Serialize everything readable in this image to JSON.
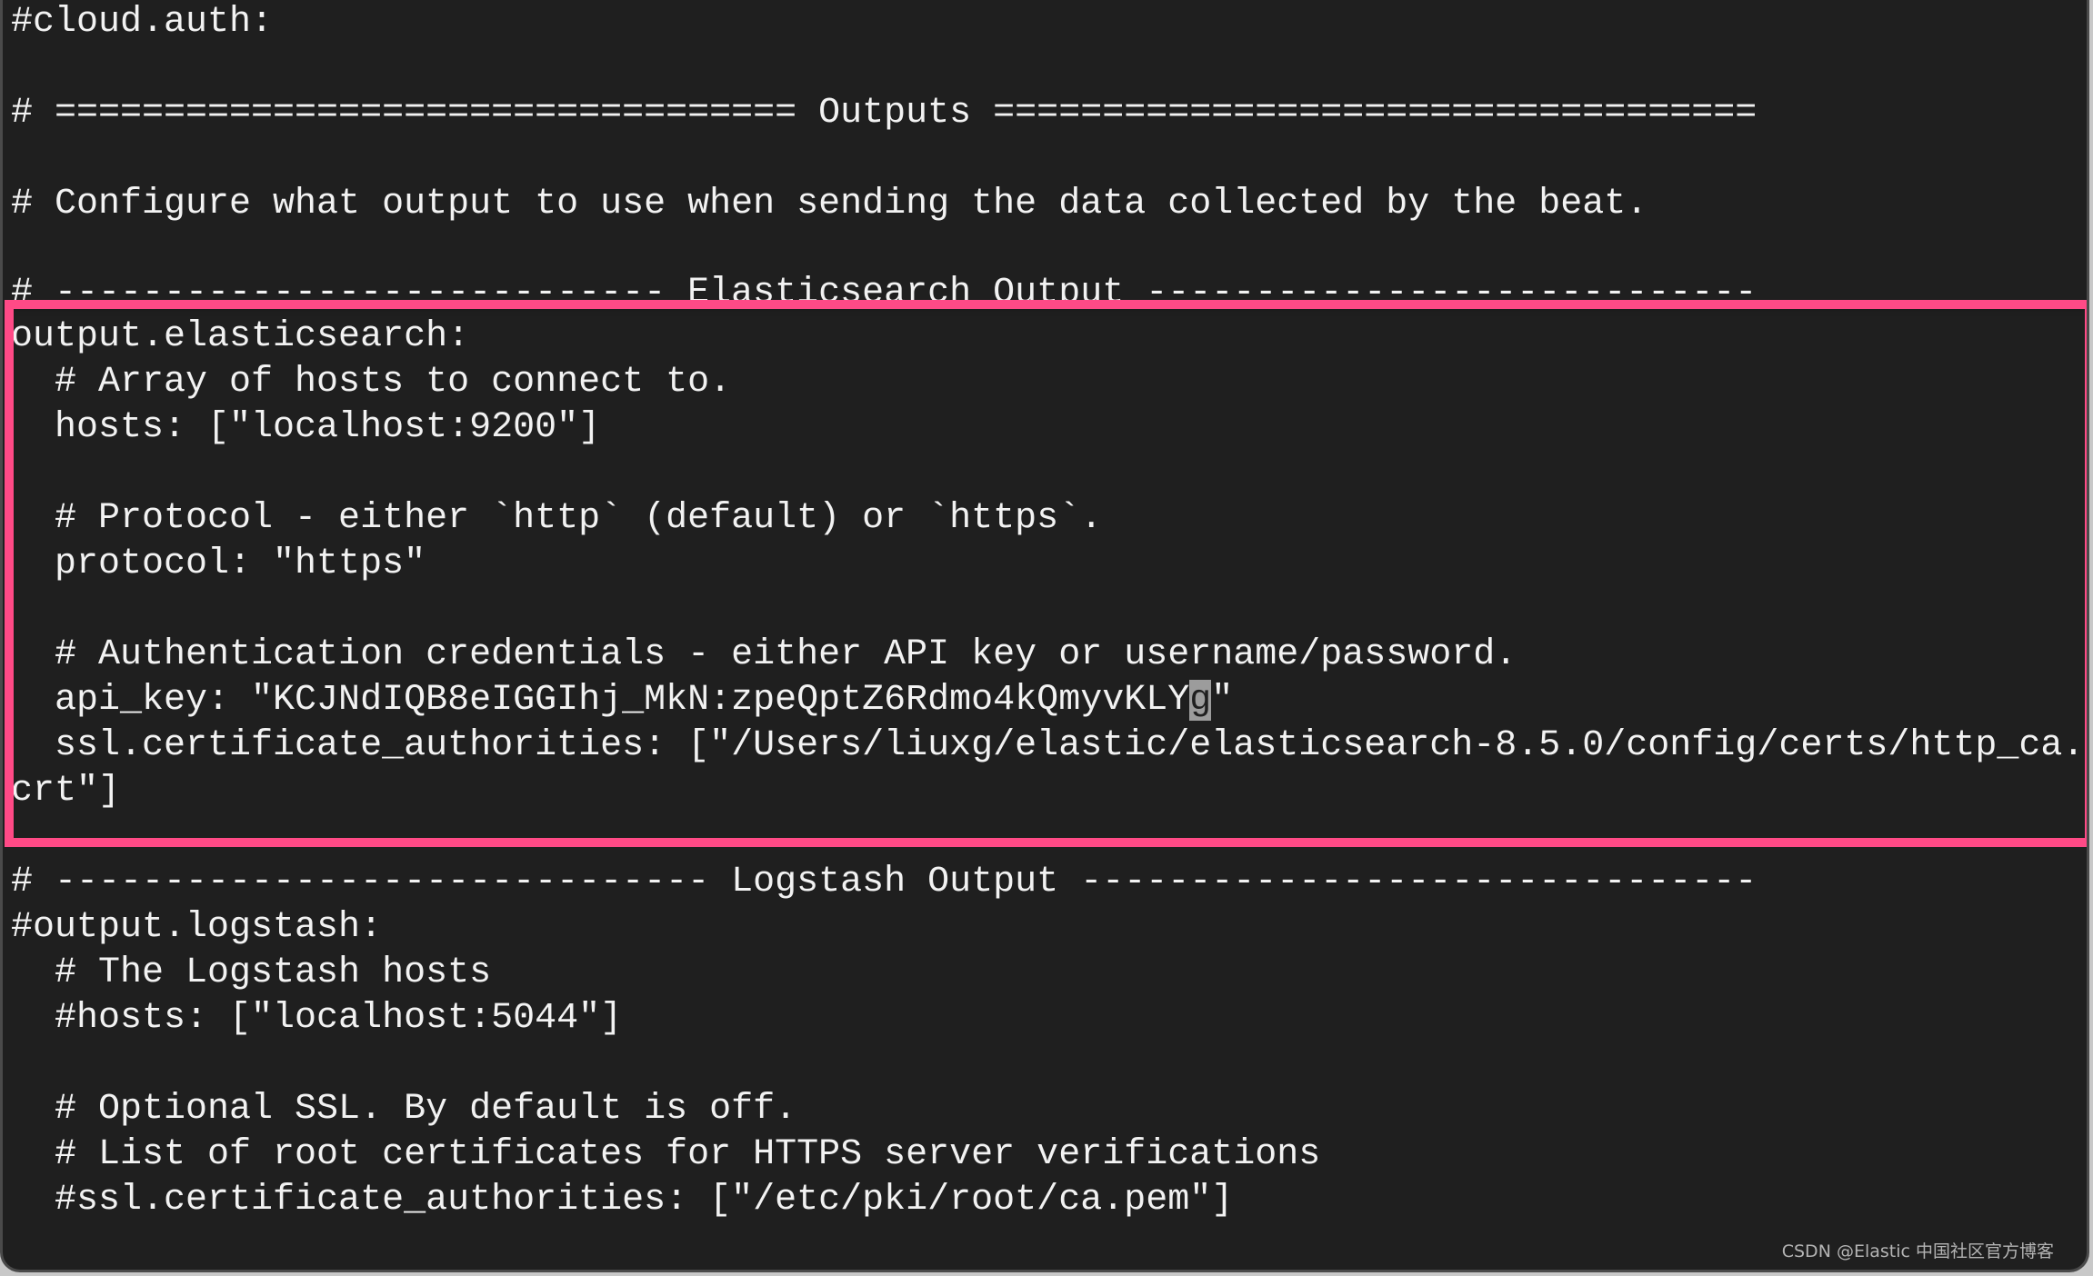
{
  "app": {
    "type": "terminal-editor",
    "file_content_type": "filebeat.yml"
  },
  "editor": {
    "pre_box_lines": [
      "#cloud.auth:",
      "",
      "# ================================== Outputs ===================================",
      "",
      "# Configure what output to use when sending the data collected by the beat.",
      "",
      "# ---------------------------- Elasticsearch Output ----------------------------"
    ],
    "highlighted_block": {
      "highlight_color": "#ff4a86",
      "lines": [
        "output.elasticsearch:",
        "  # Array of hosts to connect to.",
        "  hosts: [\"localhost:9200\"]",
        "",
        "  # Protocol - either `http` (default) or `https`.",
        "  protocol: \"https\"",
        "",
        "  # Authentication credentials - either API key or username/password.",
        "  api_key: \"KCJNdIQB8eIGGIhj_MkN:zpeQptZ6Rdmo4kQmyvKLY",
        "  ssl.certificate_authorities: [\"/Users/liuxg/elastic/elasticsearch-8.5.0/config/certs/http_ca.",
        "crt\"]"
      ],
      "cursor_char": "g",
      "cursor_line_suffix": "\""
    },
    "post_box_lines": [
      "# ------------------------------ Logstash Output -------------------------------",
      "#output.logstash:",
      "  # The Logstash hosts",
      "  #hosts: [\"localhost:5044\"]",
      "",
      "  # Optional SSL. By default is off.",
      "  # List of root certificates for HTTPS server verifications",
      "  #ssl.certificate_authorities: [\"/etc/pki/root/ca.pem\"]"
    ]
  },
  "watermark": "CSDN @Elastic 中国社区官方博客",
  "colors": {
    "background": "#1f1f1f",
    "text": "#f2f2f2",
    "cursor": "#9c9c9c",
    "highlight_border": "#ff4a86"
  }
}
